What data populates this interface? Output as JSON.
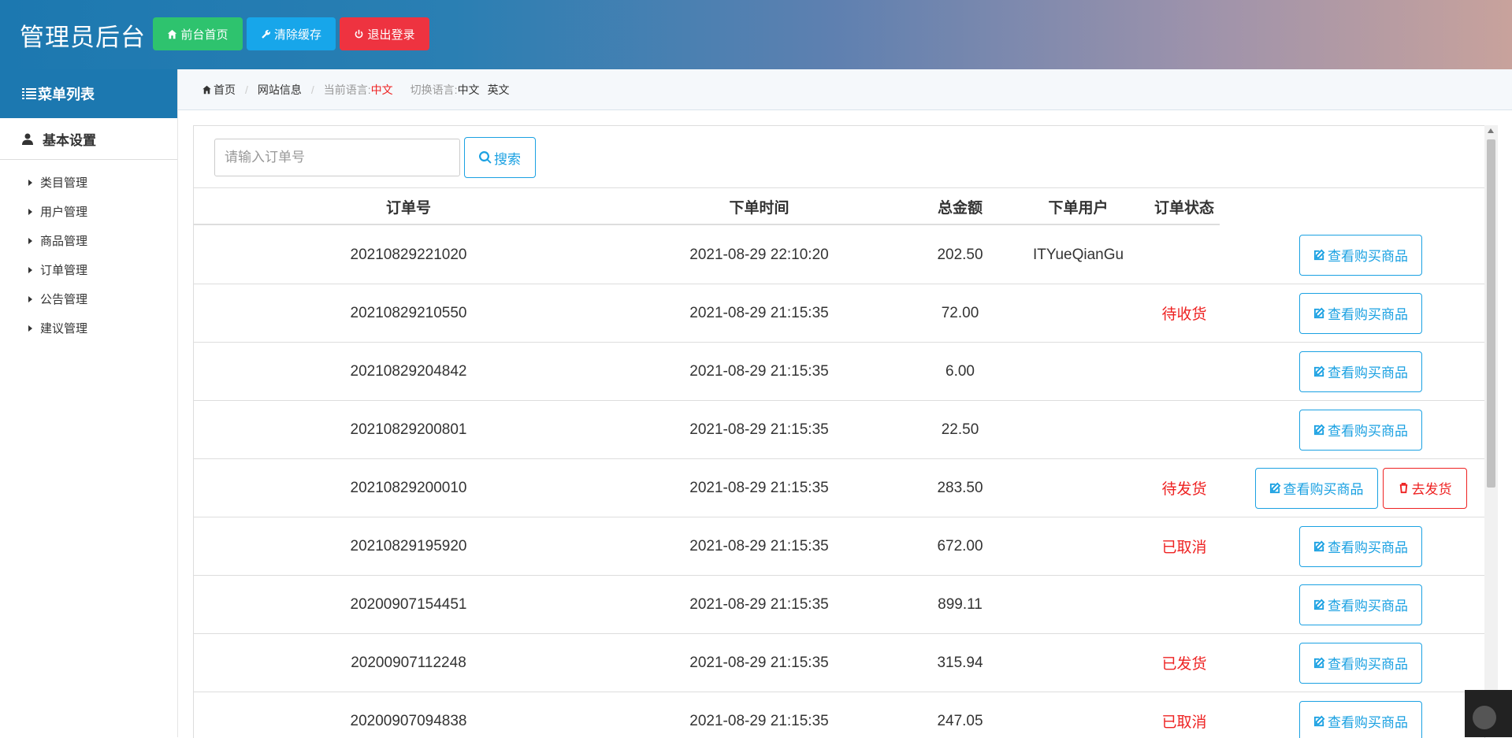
{
  "header": {
    "title": "管理员后台",
    "buttons": {
      "home": "前台首页",
      "clear_cache": "清除缓存",
      "logout": "退出登录"
    },
    "colors": {
      "home": "#2ec36e",
      "clear_cache": "#17a6ea",
      "logout": "#ee3340"
    }
  },
  "sidebar": {
    "title": "菜单列表",
    "group": "基本设置",
    "items": [
      "类目管理",
      "用户管理",
      "商品管理",
      "订单管理",
      "公告管理",
      "建议管理"
    ]
  },
  "breadcrumb": {
    "home": "首页",
    "section": "网站信息",
    "current_lang_label": "当前语言:",
    "current_lang": "中文",
    "switch_label": "切换语言:",
    "lang_zh": "中文",
    "lang_en": "英文"
  },
  "search": {
    "placeholder": "请输入订单号",
    "button": "搜索"
  },
  "table": {
    "headers": {
      "id": "订单号",
      "time": "下单时间",
      "total": "总金额",
      "user": "下单用户",
      "status": "订单状态"
    },
    "view_label": "查看购买商品",
    "ship_label": "去发货",
    "rows": [
      {
        "id": "20210829221020",
        "time": "2021-08-29 22:10:20",
        "total": "202.50",
        "user": "ITYueQianGu",
        "status": "",
        "ship": false
      },
      {
        "id": "20210829210550",
        "time": "2021-08-29 21:15:35",
        "total": "72.00",
        "user": "",
        "status": "待收货",
        "ship": false
      },
      {
        "id": "20210829204842",
        "time": "2021-08-29 21:15:35",
        "total": "6.00",
        "user": "",
        "status": "",
        "ship": false
      },
      {
        "id": "20210829200801",
        "time": "2021-08-29 21:15:35",
        "total": "22.50",
        "user": "",
        "status": "",
        "ship": false
      },
      {
        "id": "20210829200010",
        "time": "2021-08-29 21:15:35",
        "total": "283.50",
        "user": "",
        "status": "待发货",
        "ship": true
      },
      {
        "id": "20210829195920",
        "time": "2021-08-29 21:15:35",
        "total": "672.00",
        "user": "",
        "status": "已取消",
        "ship": false
      },
      {
        "id": "20200907154451",
        "time": "2021-08-29 21:15:35",
        "total": "899.11",
        "user": "",
        "status": "",
        "ship": false
      },
      {
        "id": "20200907112248",
        "time": "2021-08-29 21:15:35",
        "total": "315.94",
        "user": "",
        "status": "已发货",
        "ship": false
      },
      {
        "id": "20200907094838",
        "time": "2021-08-29 21:15:35",
        "total": "247.05",
        "user": "",
        "status": "已取消",
        "ship": false
      }
    ]
  }
}
